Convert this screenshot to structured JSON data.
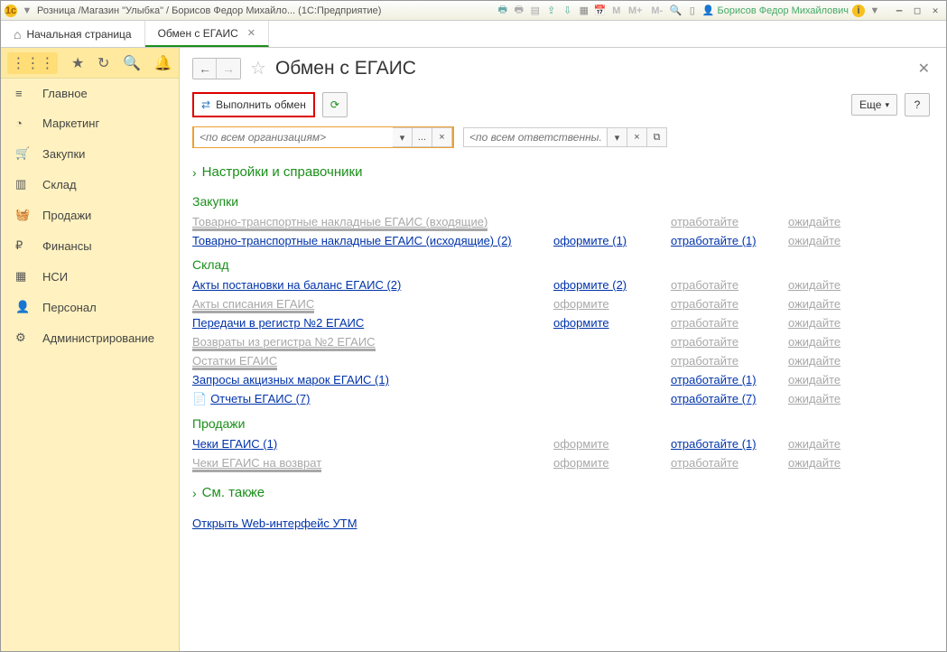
{
  "titlebar": {
    "app_label": "Розница /Магазин \"Улыбка\" / Борисов Федор Михайло... (1С:Предприятие)",
    "user": "Борисов Федор Михайлович",
    "m_labels": [
      "М",
      "М+",
      "М-"
    ]
  },
  "tabs": {
    "home": "Начальная страница",
    "active": "Обмен с ЕГАИС"
  },
  "sidebar": {
    "items": [
      {
        "icon": "≡",
        "label": "Главное"
      },
      {
        "icon": "◔",
        "label": "Маркетинг"
      },
      {
        "icon": "🛒",
        "label": "Закупки"
      },
      {
        "icon": "▥",
        "label": "Склад"
      },
      {
        "icon": "🧺",
        "label": "Продажи"
      },
      {
        "icon": "₽",
        "label": "Финансы"
      },
      {
        "icon": "▦",
        "label": "НСИ"
      },
      {
        "icon": "👤",
        "label": "Персонал"
      },
      {
        "icon": "⚙",
        "label": "Администрирование"
      }
    ]
  },
  "page": {
    "title": "Обмен с ЕГАИС",
    "exec_btn": "Выполнить обмен",
    "more_btn": "Еще",
    "help_btn": "?",
    "filter_org_ph": "<по всем организациям>",
    "filter_resp_ph": "<по всем ответственны...",
    "sect_settings": "Настройки и справочники",
    "sect_see_also": "См. также",
    "footer_link": "Открыть Web-интерфейс УТМ",
    "groups": {
      "zakupki": {
        "title": "Закупки",
        "rows": [
          {
            "name": "Товарно-транспортные накладные ЕГАИС (входящие)",
            "name_enabled": false,
            "c2": "",
            "c3": "отработайте",
            "c3_enabled": false,
            "c4": "ожидайте",
            "c4_enabled": false
          },
          {
            "name": "Товарно-транспортные накладные ЕГАИС (исходящие) (2)",
            "name_enabled": true,
            "c2": "оформите (1)",
            "c2_enabled": true,
            "c3": "отработайте (1)",
            "c3_enabled": true,
            "c4": "ожидайте",
            "c4_enabled": false
          }
        ]
      },
      "sklad": {
        "title": "Склад",
        "rows": [
          {
            "name": "Акты постановки на баланс ЕГАИС (2)",
            "name_enabled": true,
            "c2": "оформите (2)",
            "c2_enabled": true,
            "c3": "отработайте",
            "c3_enabled": false,
            "c4": "ожидайте",
            "c4_enabled": false
          },
          {
            "name": "Акты списания ЕГАИС",
            "name_enabled": false,
            "c2": "оформите",
            "c2_enabled": false,
            "c3": "отработайте",
            "c3_enabled": false,
            "c4": "ожидайте",
            "c4_enabled": false
          },
          {
            "name": "Передачи в регистр №2 ЕГАИС",
            "name_enabled": true,
            "c2": "оформите",
            "c2_enabled": true,
            "c3": "отработайте",
            "c3_enabled": false,
            "c4": "ожидайте",
            "c4_enabled": false
          },
          {
            "name": "Возвраты из регистра №2 ЕГАИС",
            "name_enabled": false,
            "c2": "",
            "c3": "отработайте",
            "c3_enabled": false,
            "c4": "ожидайте",
            "c4_enabled": false
          },
          {
            "name": "Остатки ЕГАИС",
            "name_enabled": false,
            "c2": "",
            "c3": "отработайте",
            "c3_enabled": false,
            "c4": "ожидайте",
            "c4_enabled": false
          },
          {
            "name": "Запросы акцизных марок ЕГАИС (1)",
            "name_enabled": true,
            "c2": "",
            "c3": "отработайте (1)",
            "c3_enabled": true,
            "c4": "ожидайте",
            "c4_enabled": false
          },
          {
            "name": "Отчеты ЕГАИС (7)",
            "name_enabled": true,
            "icon": "📄",
            "c2": "",
            "c3": "отработайте (7)",
            "c3_enabled": true,
            "c4": "ожидайте",
            "c4_enabled": false
          }
        ]
      },
      "prodazhi": {
        "title": "Продажи",
        "rows": [
          {
            "name": "Чеки ЕГАИС (1)",
            "name_enabled": true,
            "c2": "оформите",
            "c2_enabled": false,
            "c3": "отработайте (1)",
            "c3_enabled": true,
            "c4": "ожидайте",
            "c4_enabled": false
          },
          {
            "name": "Чеки ЕГАИС на возврат",
            "name_enabled": false,
            "c2": "оформите",
            "c2_enabled": false,
            "c3": "отработайте",
            "c3_enabled": false,
            "c4": "ожидайте",
            "c4_enabled": false
          }
        ]
      }
    }
  }
}
